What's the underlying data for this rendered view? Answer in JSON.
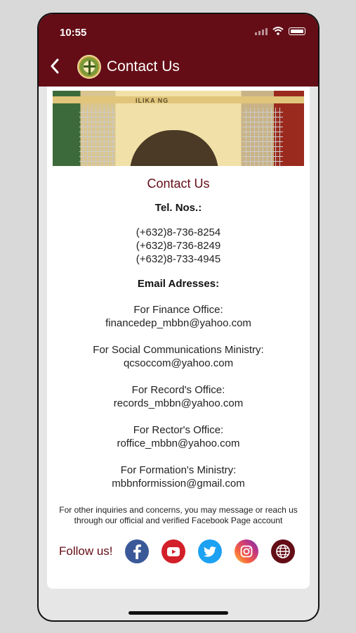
{
  "status": {
    "time": "10:55"
  },
  "header": {
    "title": "Contact Us"
  },
  "banner": {
    "sign_text": "ILIKA NG"
  },
  "contact": {
    "title": "Contact Us",
    "tel_label": "Tel. Nos.:",
    "phones": [
      "(+632)8-736-8254",
      "(+632)8-736-8249",
      "(+632)8-733-4945"
    ],
    "email_label": "Email Adresses:",
    "emails": [
      {
        "label": "For Finance Office:",
        "address": "financedep_mbbn@yahoo.com"
      },
      {
        "label": "For Social Communications Ministry:",
        "address": "qcsoccom@yahoo.com"
      },
      {
        "label": "For Record's Office:",
        "address": "records_mbbn@yahoo.com"
      },
      {
        "label": "For Rector's Office:",
        "address": "roffice_mbbn@yahoo.com"
      },
      {
        "label": "For Formation's Ministry:",
        "address": "mbbnformission@gmail.com"
      }
    ],
    "note": "For other inquiries and concerns, you may message or reach us through our official and verified Facebook Page account"
  },
  "follow": {
    "label": "Follow us!",
    "icons": [
      "facebook-icon",
      "youtube-icon",
      "twitter-icon",
      "instagram-icon",
      "globe-icon"
    ]
  },
  "colors": {
    "brand": "#640d16",
    "facebook": "#3b5998",
    "youtube": "#d21f2a",
    "twitter": "#1da1f2"
  }
}
